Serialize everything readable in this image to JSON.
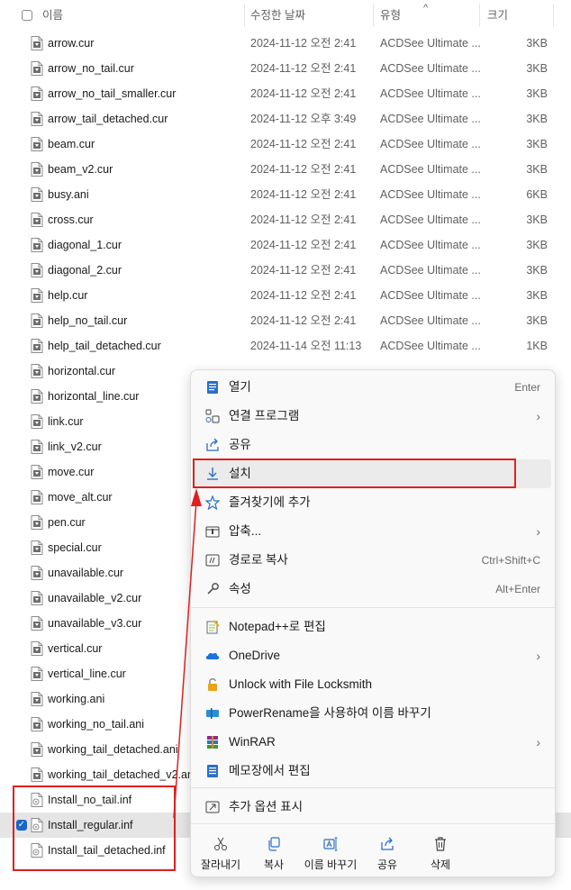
{
  "header": {
    "name_label": "이름",
    "date_label": "수정한 날짜",
    "type_label": "유형",
    "size_label": "크기",
    "sort_arrow": "^"
  },
  "files": [
    {
      "name": "arrow.cur",
      "date": "2024-11-12 오전 2:41",
      "type": "ACDSee Ultimate ...",
      "size": "3KB"
    },
    {
      "name": "arrow_no_tail.cur",
      "date": "2024-11-12 오전 2:41",
      "type": "ACDSee Ultimate ...",
      "size": "3KB"
    },
    {
      "name": "arrow_no_tail_smaller.cur",
      "date": "2024-11-12 오전 2:41",
      "type": "ACDSee Ultimate ...",
      "size": "3KB"
    },
    {
      "name": "arrow_tail_detached.cur",
      "date": "2024-11-12 오후 3:49",
      "type": "ACDSee Ultimate ...",
      "size": "3KB"
    },
    {
      "name": "beam.cur",
      "date": "2024-11-12 오전 2:41",
      "type": "ACDSee Ultimate ...",
      "size": "3KB"
    },
    {
      "name": "beam_v2.cur",
      "date": "2024-11-12 오전 2:41",
      "type": "ACDSee Ultimate ...",
      "size": "3KB"
    },
    {
      "name": "busy.ani",
      "date": "2024-11-12 오전 2:41",
      "type": "ACDSee Ultimate ...",
      "size": "6KB"
    },
    {
      "name": "cross.cur",
      "date": "2024-11-12 오전 2:41",
      "type": "ACDSee Ultimate ...",
      "size": "3KB"
    },
    {
      "name": "diagonal_1.cur",
      "date": "2024-11-12 오전 2:41",
      "type": "ACDSee Ultimate ...",
      "size": "3KB"
    },
    {
      "name": "diagonal_2.cur",
      "date": "2024-11-12 오전 2:41",
      "type": "ACDSee Ultimate ...",
      "size": "3KB"
    },
    {
      "name": "help.cur",
      "date": "2024-11-12 오전 2:41",
      "type": "ACDSee Ultimate ...",
      "size": "3KB"
    },
    {
      "name": "help_no_tail.cur",
      "date": "2024-11-12 오전 2:41",
      "type": "ACDSee Ultimate ...",
      "size": "3KB"
    },
    {
      "name": "help_tail_detached.cur",
      "date": "2024-11-14 오전 11:13",
      "type": "ACDSee Ultimate ...",
      "size": "1KB"
    },
    {
      "name": "horizontal.cur",
      "date": "",
      "type": "",
      "size": ""
    },
    {
      "name": "horizontal_line.cur",
      "date": "",
      "type": "",
      "size": ""
    },
    {
      "name": "link.cur",
      "date": "",
      "type": "",
      "size": ""
    },
    {
      "name": "link_v2.cur",
      "date": "",
      "type": "",
      "size": ""
    },
    {
      "name": "move.cur",
      "date": "",
      "type": "",
      "size": ""
    },
    {
      "name": "move_alt.cur",
      "date": "",
      "type": "",
      "size": ""
    },
    {
      "name": "pen.cur",
      "date": "",
      "type": "",
      "size": ""
    },
    {
      "name": "special.cur",
      "date": "",
      "type": "",
      "size": ""
    },
    {
      "name": "unavailable.cur",
      "date": "",
      "type": "",
      "size": ""
    },
    {
      "name": "unavailable_v2.cur",
      "date": "",
      "type": "",
      "size": ""
    },
    {
      "name": "unavailable_v3.cur",
      "date": "",
      "type": "",
      "size": ""
    },
    {
      "name": "vertical.cur",
      "date": "",
      "type": "",
      "size": ""
    },
    {
      "name": "vertical_line.cur",
      "date": "",
      "type": "",
      "size": ""
    },
    {
      "name": "working.ani",
      "date": "",
      "type": "",
      "size": ""
    },
    {
      "name": "working_no_tail.ani",
      "date": "",
      "type": "",
      "size": ""
    },
    {
      "name": "working_tail_detached.ani",
      "date": "",
      "type": "",
      "size": ""
    },
    {
      "name": "working_tail_detached_v2.ani",
      "date": "",
      "type": "",
      "size": ""
    },
    {
      "name": "Install_no_tail.inf",
      "date": "",
      "type": "",
      "size": ""
    },
    {
      "name": "Install_regular.inf",
      "date": "",
      "type": "",
      "size": "",
      "selected": true
    },
    {
      "name": "Install_tail_detached.inf",
      "date": "",
      "type": "",
      "size": ""
    }
  ],
  "menu": {
    "items": [
      {
        "label": "열기",
        "shortcut": "Enter",
        "icon": "open-icon"
      },
      {
        "label": "연결 프로그램",
        "chevron": "›",
        "icon": "open-with-icon"
      },
      {
        "label": "공유",
        "icon": "share-icon"
      },
      {
        "label": "설치",
        "icon": "install-icon",
        "highlighted": true
      },
      {
        "label": "즐겨찾기에 추가",
        "icon": "star-icon"
      },
      {
        "label": "압축...",
        "chevron": "›",
        "icon": "compress-icon"
      },
      {
        "label": "경로로 복사",
        "shortcut": "Ctrl+Shift+C",
        "icon": "copy-path-icon"
      },
      {
        "label": "속성",
        "shortcut": "Alt+Enter",
        "icon": "properties-icon"
      },
      {
        "label": "Notepad++로 편집",
        "icon": "notepadpp-icon"
      },
      {
        "label": "OneDrive",
        "chevron": "›",
        "icon": "onedrive-icon"
      },
      {
        "label": "Unlock with File Locksmith",
        "icon": "lock-icon"
      },
      {
        "label": "PowerRename을 사용하여 이름 바꾸기",
        "icon": "powerrename-icon"
      },
      {
        "label": "WinRAR",
        "chevron": "›",
        "icon": "winrar-icon"
      },
      {
        "label": "메모장에서 편집",
        "icon": "notepad-icon"
      },
      {
        "label": "추가 옵션 표시",
        "icon": "more-options-icon"
      }
    ],
    "bottom": [
      {
        "label": "잘라내기",
        "icon": "cut-icon"
      },
      {
        "label": "복사",
        "icon": "copy-icon"
      },
      {
        "label": "이름 바꾸기",
        "icon": "rename-icon"
      },
      {
        "label": "공유",
        "icon": "share-icon"
      },
      {
        "label": "삭제",
        "icon": "trash-icon"
      }
    ]
  },
  "colors": {
    "annotation": "#e0201f",
    "accent": "#1a66c9"
  }
}
